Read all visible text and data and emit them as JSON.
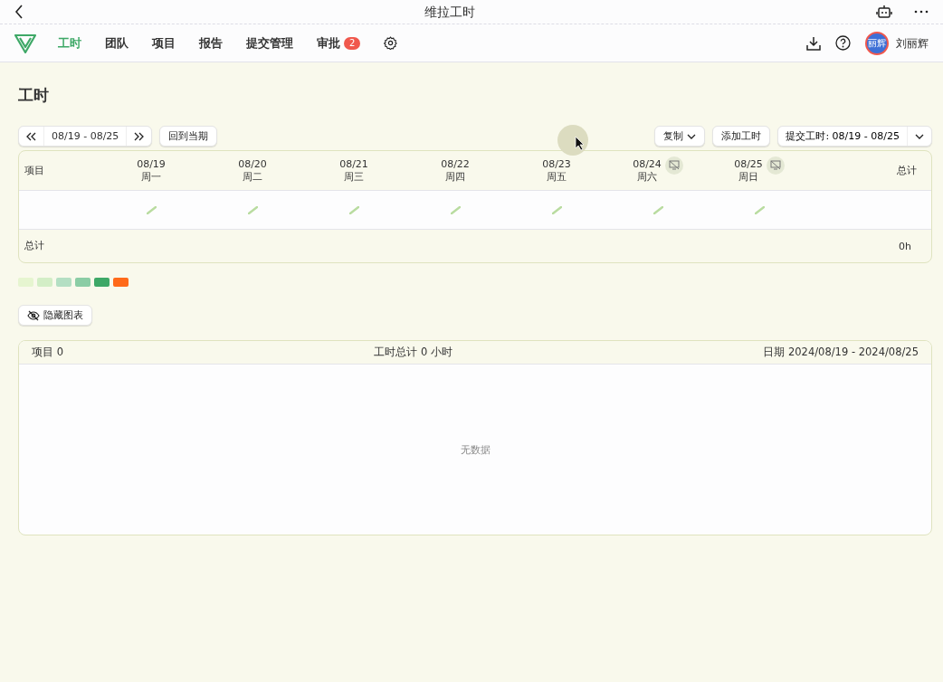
{
  "window": {
    "title": "维拉工时"
  },
  "nav": {
    "items": [
      {
        "label": "工时",
        "selected": true
      },
      {
        "label": "团队",
        "selected": false
      },
      {
        "label": "项目",
        "selected": false
      },
      {
        "label": "报告",
        "selected": false
      },
      {
        "label": "提交管理",
        "selected": false
      },
      {
        "label": "审批",
        "selected": false,
        "badge": "2"
      }
    ],
    "avatar_text": "丽辉",
    "user_name": "刘丽辉"
  },
  "page_title": "工时",
  "toolbar": {
    "range": "08/19 - 08/25",
    "today_button": "回到当期",
    "copy_button": "复制",
    "add_button": "添加工时",
    "submit_button": "提交工时: 08/19 - 08/25"
  },
  "table": {
    "project_header": "项目",
    "total_header": "总计",
    "days": [
      {
        "date": "08/19",
        "weekday": "周一",
        "hidden": false
      },
      {
        "date": "08/20",
        "weekday": "周二",
        "hidden": false
      },
      {
        "date": "08/21",
        "weekday": "周三",
        "hidden": false
      },
      {
        "date": "08/22",
        "weekday": "周四",
        "hidden": false
      },
      {
        "date": "08/23",
        "weekday": "周五",
        "hidden": false
      },
      {
        "date": "08/24",
        "weekday": "周六",
        "hidden": true
      },
      {
        "date": "08/25",
        "weekday": "周日",
        "hidden": true
      }
    ],
    "total_label": "总计",
    "total_value": "0h"
  },
  "legend": [
    {
      "color": "#e6f5d0"
    },
    {
      "color": "#d3eec6"
    },
    {
      "color": "#b4dfc3"
    },
    {
      "color": "#8bcda5"
    },
    {
      "color": "#3ea867"
    },
    {
      "color": "#ff6a1a"
    }
  ],
  "hide_chart_button": "隐藏图表",
  "summary": {
    "projects": "项目 0",
    "hours": "工时总计 0 小时",
    "dates": "日期 2024/08/19 - 2024/08/25",
    "empty": "无数据"
  }
}
